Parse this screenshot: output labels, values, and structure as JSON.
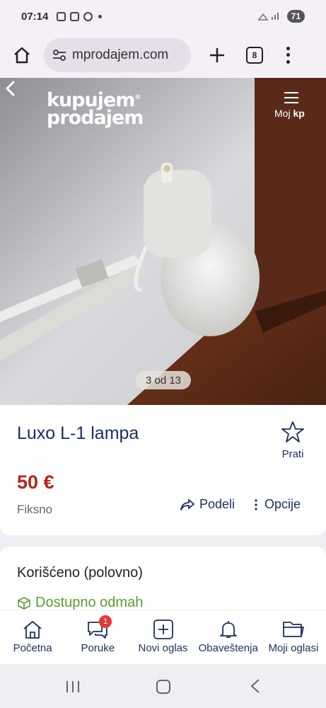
{
  "status": {
    "time": "07:14",
    "battery": "71"
  },
  "browser": {
    "url": "mprodajem.com",
    "tabs_count": "8"
  },
  "site": {
    "logo_line1": "kupujem",
    "logo_line2": "prodajem",
    "account_label": "Moj",
    "account_label_bold": "kp"
  },
  "gallery": {
    "counter": "3 od 13"
  },
  "listing": {
    "title": "Luxo L-1 lampa",
    "follow_label": "Prati",
    "price": "50 €",
    "price_type": "Fiksno",
    "share_label": "Podeli",
    "options_label": "Opcije",
    "condition": "Korišćeno (polovno)",
    "availability": "Dostupno odmah"
  },
  "bottom_nav": {
    "items": [
      {
        "label": "Početna",
        "icon": "home-icon"
      },
      {
        "label": "Poruke",
        "icon": "chat-icon",
        "badge": "1"
      },
      {
        "label": "Novi oglas",
        "icon": "add-icon"
      },
      {
        "label": "Obaveštenja",
        "icon": "bell-icon"
      },
      {
        "label": "Moji oglasi",
        "icon": "folder-icon"
      }
    ]
  },
  "colors": {
    "brand_navy": "#1b2e5e",
    "price_red": "#b3261e",
    "available_green": "#5a9e2f"
  }
}
